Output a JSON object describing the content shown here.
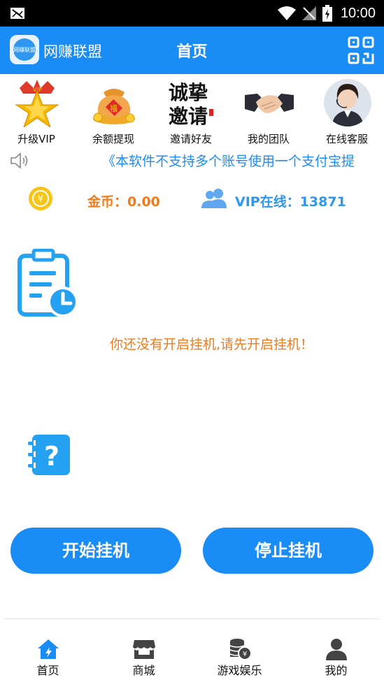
{
  "status_bar": {
    "time": "10:00"
  },
  "header": {
    "app_name": "网赚联盟",
    "logo_text": "网赚联盟",
    "title": "首页"
  },
  "features": [
    {
      "label": "升级VIP",
      "icon": "vip-crown-icon"
    },
    {
      "label": "余额提现",
      "icon": "money-bag-icon"
    },
    {
      "label": "邀请好友",
      "icon": "invite-calligraphy-icon",
      "art_text": "诚挚邀请"
    },
    {
      "label": "我的团队",
      "icon": "handshake-icon"
    },
    {
      "label": "在线客服",
      "icon": "support-agent-icon"
    }
  ],
  "notice": {
    "text": "《本软件不支持多个账号使用一个支付宝提"
  },
  "stats": {
    "coins": "金币：0.00",
    "vip_online": "VIP在线：13871",
    "coin_symbol": "¥"
  },
  "content": {
    "empty_message": "你还没有开启挂机,请先开启挂机！",
    "help_symbol": "?"
  },
  "buttons": {
    "start": "开始挂机",
    "stop": "停止挂机"
  },
  "nav": [
    {
      "label": "首页",
      "icon": "home-icon"
    },
    {
      "label": "商城",
      "icon": "shop-icon"
    },
    {
      "label": "游戏娱乐",
      "icon": "game-coins-icon"
    },
    {
      "label": "我的",
      "icon": "profile-icon"
    }
  ],
  "colors": {
    "primary": "#1a8cf5",
    "accent": "#f07b18",
    "vip": "#2f97f0"
  }
}
